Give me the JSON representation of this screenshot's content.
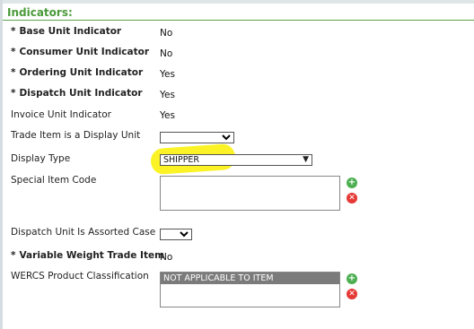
{
  "section": {
    "title": "Indicators:"
  },
  "rows": {
    "base_unit": {
      "label": "Base Unit Indicator",
      "value": "No"
    },
    "consumer_unit": {
      "label": "Consumer Unit Indicator",
      "value": "No"
    },
    "ordering_unit": {
      "label": "Ordering Unit Indicator",
      "value": "Yes"
    },
    "dispatch_unit": {
      "label": "Dispatch Unit Indicator",
      "value": "Yes"
    },
    "invoice_unit": {
      "label": "Invoice Unit Indicator",
      "value": "Yes"
    },
    "display_unit": {
      "label": "Trade Item is a Display Unit",
      "value": ""
    },
    "display_type": {
      "label": "Display Type",
      "value": "SHIPPER"
    },
    "special_item_code": {
      "label": "Special Item Code",
      "value": ""
    },
    "assorted_case": {
      "label": "Dispatch Unit Is Assorted Case",
      "value": ""
    },
    "variable_weight": {
      "label": "Variable Weight Trade Item",
      "value": "No"
    },
    "wercs": {
      "label": "WERCS Product Classification",
      "options": [
        "NOT APPLICABLE TO ITEM"
      ]
    }
  },
  "required_marker": "*",
  "icons": {
    "add": "plus-circle-green",
    "remove": "x-circle-red"
  },
  "colors": {
    "section_title": "#4a9a3a",
    "highlight": "#fbf325",
    "add": "#4caf50",
    "remove": "#e53935"
  }
}
